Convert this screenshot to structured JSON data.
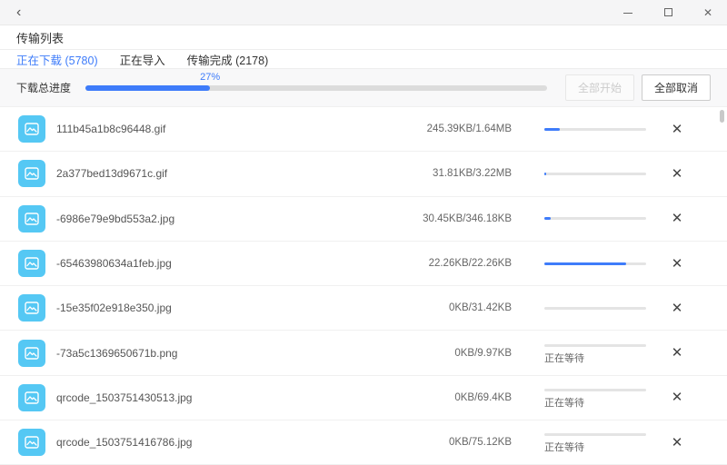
{
  "colors": {
    "accent": "#3e7cfa",
    "icon-bg": "#55c8f4"
  },
  "titlebar": {
    "back_icon": "‹",
    "minimize_icon": "minimize",
    "maximize_icon": "maximize",
    "close_icon": "✕"
  },
  "header": {
    "title": "传输列表"
  },
  "tabs": [
    {
      "label": "正在下载 (5780)",
      "active": true
    },
    {
      "label": "正在导入",
      "active": false
    },
    {
      "label": "传输完成 (2178)",
      "active": false
    }
  ],
  "progress_section": {
    "label": "下载总进度",
    "percent_text": "27%",
    "percent_value": 27,
    "start_all_label": "全部开始",
    "start_all_enabled": false,
    "cancel_all_label": "全部取消"
  },
  "files": [
    {
      "name": "111b45a1b8c96448.gif",
      "size": "245.39KB/1.64MB",
      "progress": 15,
      "status": ""
    },
    {
      "name": "2a377bed13d9671c.gif",
      "size": "31.81KB/3.22MB",
      "progress": 2,
      "status": ""
    },
    {
      "name": "-6986e79e9bd553a2.jpg",
      "size": "30.45KB/346.18KB",
      "progress": 6,
      "status": ""
    },
    {
      "name": "-65463980634a1feb.jpg",
      "size": "22.26KB/22.26KB",
      "progress": 80,
      "status": ""
    },
    {
      "name": "-15e35f02e918e350.jpg",
      "size": "0KB/31.42KB",
      "progress": 0,
      "status": ""
    },
    {
      "name": "-73a5c1369650671b.png",
      "size": "0KB/9.97KB",
      "progress": 0,
      "status": "正在等待"
    },
    {
      "name": "qrcode_1503751430513.jpg",
      "size": "0KB/69.4KB",
      "progress": 0,
      "status": "正在等待"
    },
    {
      "name": "qrcode_1503751416786.jpg",
      "size": "0KB/75.12KB",
      "progress": 0,
      "status": "正在等待"
    }
  ],
  "row_close_icon": "✕"
}
